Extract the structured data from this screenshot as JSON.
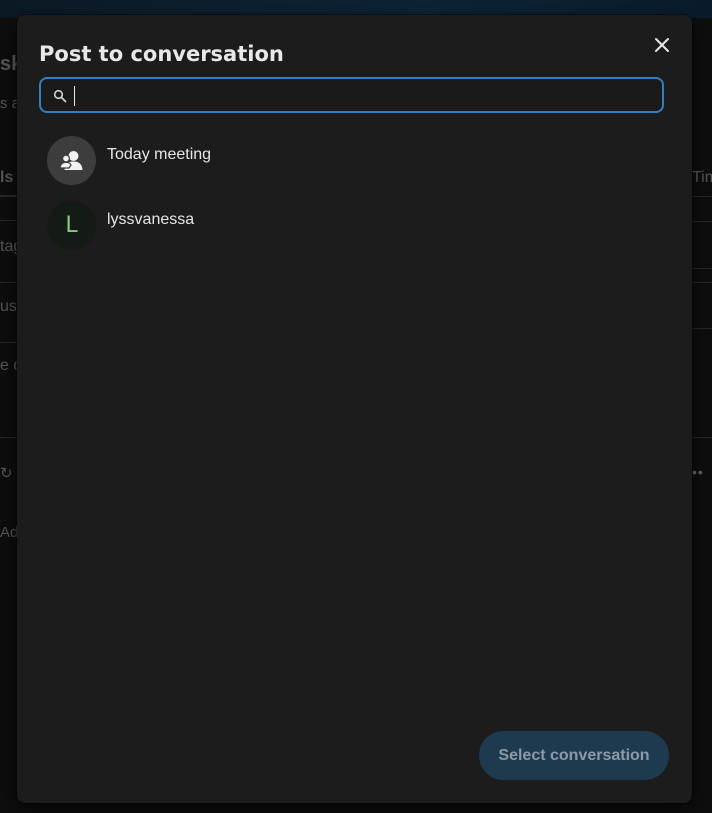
{
  "dialog": {
    "title": "Post to conversation",
    "search": {
      "value": "",
      "placeholder": ""
    },
    "conversations": [
      {
        "name": "Today meeting",
        "avatar_type": "group",
        "avatar_icon": "group-icon"
      },
      {
        "name": "lyssvanessa",
        "avatar_type": "letter",
        "avatar_letter": "L"
      }
    ],
    "select_button_label": "Select conversation",
    "close_icon": "close-icon"
  },
  "background": {
    "fragments": [
      "sk",
      "s a",
      "ls",
      "tag",
      "use",
      "e d",
      "Ado",
      "Tim"
    ]
  },
  "colors": {
    "modal_bg": "#1c1c1c",
    "accent_border": "#2f7fc1",
    "button_disabled_bg": "#1e3a4f",
    "button_disabled_text": "#8a9aa6",
    "letter_avatar_text": "#8fc48a"
  }
}
